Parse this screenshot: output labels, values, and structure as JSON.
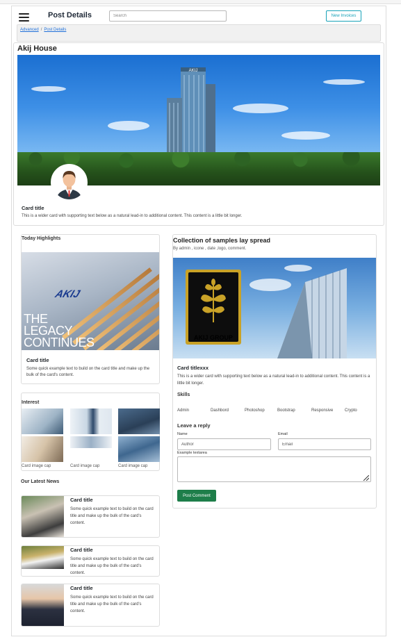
{
  "header": {
    "title": "Post Details",
    "search_placeholder": "Search",
    "new_invoices_label": "New Invoices"
  },
  "breadcrumb": {
    "items": [
      "Advanced",
      "Post Details"
    ],
    "separator": "/"
  },
  "hero": {
    "title": "Akij House",
    "card_title": "Card title",
    "card_text": "This is a wider card with supporting text below as a natural lead-in to additional content. This content is a little bit longer."
  },
  "highlights": {
    "section_title": "Today Highlights",
    "image_text_brand": "AKIJ",
    "image_text_lines": [
      "THE",
      "LEGACY",
      "CONTINUES"
    ],
    "card_title": "Card title",
    "card_text": "Some quick example text to build on the card title and make up the bulk of the card's content."
  },
  "interest": {
    "section_title": "Interest",
    "captions": [
      "Card image cap",
      "Card image cap",
      "Card image cap"
    ]
  },
  "news": {
    "section_title": "Our Latest News",
    "items": [
      {
        "title": "Card title",
        "text": "Some quick example text to build on the card title and make up the bulk of the card's content."
      },
      {
        "title": "Card title",
        "text": "Some quick example text to build on the card title and make up the bulk of the card's content."
      },
      {
        "title": "Card title",
        "text": "Some quick example text to build on the card title and make up the bulk of the card's content."
      }
    ]
  },
  "post": {
    "title": "Collection of samples lay spread",
    "meta": "By admin , icone , date ,logo, comment.",
    "logo_label": "AKIJ GROUP",
    "card_title": "Card titlexxx",
    "card_text": "This is a wider card with supporting text below as a natural lead-in to additional content. This content is a little bit longer.",
    "skills_title": "Skills",
    "skills": [
      "Admin",
      "Dashbord",
      "Photoshop",
      "Bootstrap",
      "Responsive",
      "Crypto"
    ]
  },
  "reply": {
    "title": "Leave a reply",
    "name_label": "Name",
    "name_placeholder": "Author",
    "email_label": "Email",
    "email_placeholder": "Email",
    "textarea_label": "Example textarea",
    "submit_label": "Post Comment"
  },
  "colors": {
    "accent_info": "#17a2b8",
    "link": "#1e6fd9",
    "submit_green": "#1e7e4a"
  }
}
